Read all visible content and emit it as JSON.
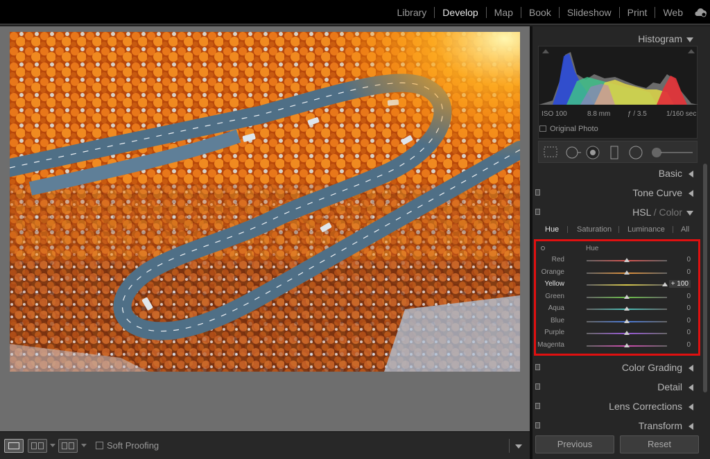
{
  "modules": [
    "Library",
    "Develop",
    "Map",
    "Book",
    "Slideshow",
    "Print",
    "Web"
  ],
  "active_module": "Develop",
  "histogram": {
    "title": "Histogram",
    "iso": "ISO 100",
    "focal": "8.8 mm",
    "aperture": "ƒ / 3.5",
    "shutter": "1/160 sec",
    "original_photo": "Original Photo"
  },
  "panels": {
    "basic": "Basic",
    "tone_curve": "Tone Curve",
    "hsl": "HSL",
    "hsl_sep": "/",
    "hsl_color": "Color",
    "color_grading": "Color Grading",
    "detail": "Detail",
    "lens": "Lens Corrections",
    "transform": "Transform"
  },
  "hsl_tabs": [
    "Hue",
    "Saturation",
    "Luminance",
    "All"
  ],
  "hue_title": "Hue",
  "sliders": [
    {
      "name": "Red",
      "value": "0",
      "pos": 0.5,
      "color": "#d9534f"
    },
    {
      "name": "Orange",
      "value": "0",
      "pos": 0.5,
      "color": "#e0913a"
    },
    {
      "name": "Yellow",
      "value": "+ 100",
      "pos": 0.97,
      "color": "#d8c84a"
    },
    {
      "name": "Green",
      "value": "0",
      "pos": 0.5,
      "color": "#6cc04a"
    },
    {
      "name": "Aqua",
      "value": "0",
      "pos": 0.5,
      "color": "#4ac0b8"
    },
    {
      "name": "Blue",
      "value": "0",
      "pos": 0.5,
      "color": "#4a7ad8"
    },
    {
      "name": "Purple",
      "value": "0",
      "pos": 0.5,
      "color": "#9a5ad8"
    },
    {
      "name": "Magenta",
      "value": "0",
      "pos": 0.5,
      "color": "#d04ab0"
    }
  ],
  "toolbar": {
    "soft_proofing": "Soft Proofing"
  },
  "buttons": {
    "previous": "Previous",
    "reset": "Reset"
  }
}
